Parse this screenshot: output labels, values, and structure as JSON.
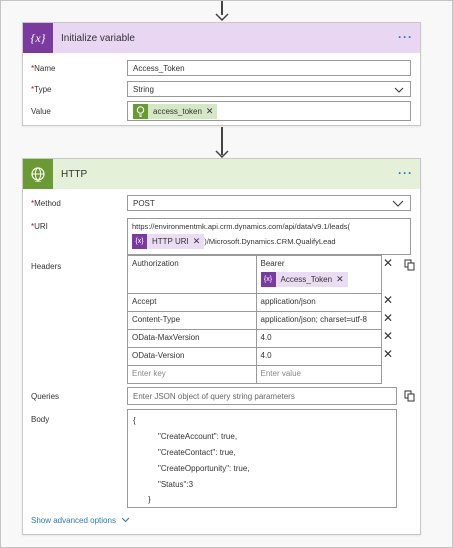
{
  "init_card": {
    "title": "Initialize variable",
    "more": "···",
    "name_label": "Name",
    "name_value": "Access_Token",
    "type_label": "Type",
    "type_value": "String",
    "value_label": "Value",
    "value_token": "access_token",
    "required_mark": "*"
  },
  "http_card": {
    "title": "HTTP",
    "more": "···",
    "method_label": "Method",
    "method_value": "POST",
    "uri_label": "URI",
    "uri_line1": "https://environmentmk.api.crm.dynamics.com/api/data/v9.1/leads(",
    "uri_token": "HTTP URI",
    "uri_suffix": ")/Microsoft.Dynamics.CRM.QualifyLead",
    "headers_label": "Headers",
    "headers": [
      {
        "key": "Authorization",
        "value": "Bearer"
      },
      {
        "key": "Accept",
        "value": "application/json"
      },
      {
        "key": "Content-Type",
        "value": "application/json; charset=utf-8"
      },
      {
        "key": "OData-MaxVersion",
        "value": "4.0"
      },
      {
        "key": "OData-Version",
        "value": "4.0"
      }
    ],
    "auth_token": "Access_Token",
    "key_placeholder": "Enter key",
    "value_placeholder": "Enter value",
    "queries_label": "Queries",
    "queries_placeholder": "Enter JSON object of query string parameters",
    "body_label": "Body",
    "body_lines": [
      "{",
      "\"CreateAccount\": true,",
      "\"CreateContact\": true,",
      "\"CreateOpportunity\": true,",
      "\"Status\":3",
      "}"
    ],
    "advanced_link": "Show advanced options",
    "required_mark": "*"
  },
  "colors": {
    "variable_accent": "#7b3aa0",
    "http_accent": "#6a9a32",
    "link": "#2a7ab8"
  },
  "icons": [
    "down-arrow-icon",
    "variable-icon",
    "globe-icon",
    "more-icon",
    "chevron-down-icon",
    "close-icon",
    "lightbulb-icon",
    "copy-icon"
  ]
}
